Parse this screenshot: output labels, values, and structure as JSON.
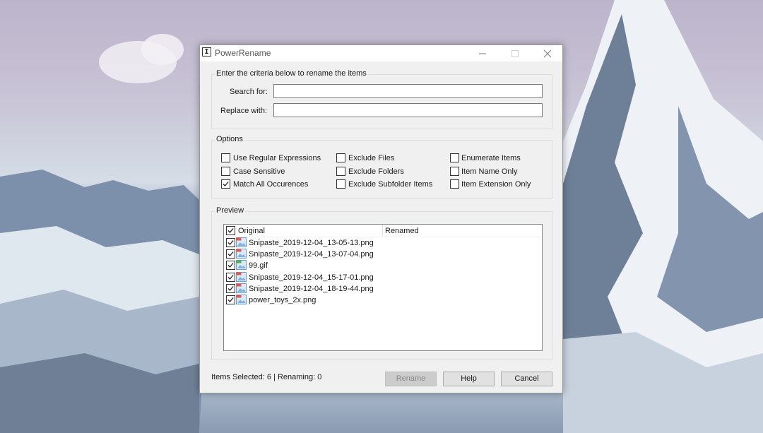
{
  "window": {
    "title": "PowerRename",
    "icon_glyph": "I"
  },
  "criteria": {
    "group_label": "Enter the criteria below to rename the items",
    "search_label": "Search for:",
    "search_value": "",
    "replace_label": "Replace with:",
    "replace_value": ""
  },
  "options": {
    "group_label": "Options",
    "items": [
      {
        "label": "Use Regular Expressions",
        "checked": false
      },
      {
        "label": "Case Sensitive",
        "checked": false
      },
      {
        "label": "Match All Occurences",
        "checked": true
      },
      {
        "label": "Exclude Files",
        "checked": false
      },
      {
        "label": "Exclude Folders",
        "checked": false
      },
      {
        "label": "Exclude Subfolder Items",
        "checked": false
      },
      {
        "label": "Enumerate Items",
        "checked": false
      },
      {
        "label": "Item Name Only",
        "checked": false
      },
      {
        "label": "Item Extension Only",
        "checked": false
      }
    ]
  },
  "preview": {
    "group_label": "Preview",
    "col_original": "Original",
    "col_renamed": "Renamed",
    "header_checked": true,
    "files": [
      {
        "name": "Snipaste_2019-12-04_13-05-13.png",
        "checked": true,
        "type": "png"
      },
      {
        "name": "Snipaste_2019-12-04_13-07-04.png",
        "checked": true,
        "type": "png"
      },
      {
        "name": "99.gif",
        "checked": true,
        "type": "gif"
      },
      {
        "name": "Snipaste_2019-12-04_15-17-01.png",
        "checked": true,
        "type": "png"
      },
      {
        "name": "Snipaste_2019-12-04_18-19-44.png",
        "checked": true,
        "type": "png"
      },
      {
        "name": "power_toys_2x.png",
        "checked": true,
        "type": "png"
      }
    ]
  },
  "status": "Items Selected: 6 | Renaming: 0",
  "buttons": {
    "rename": "Rename",
    "help": "Help",
    "cancel": "Cancel"
  },
  "icons": {
    "minimize": "minimize-icon",
    "maximize": "maximize-icon",
    "close": "close-icon",
    "file": "image-file-icon"
  }
}
